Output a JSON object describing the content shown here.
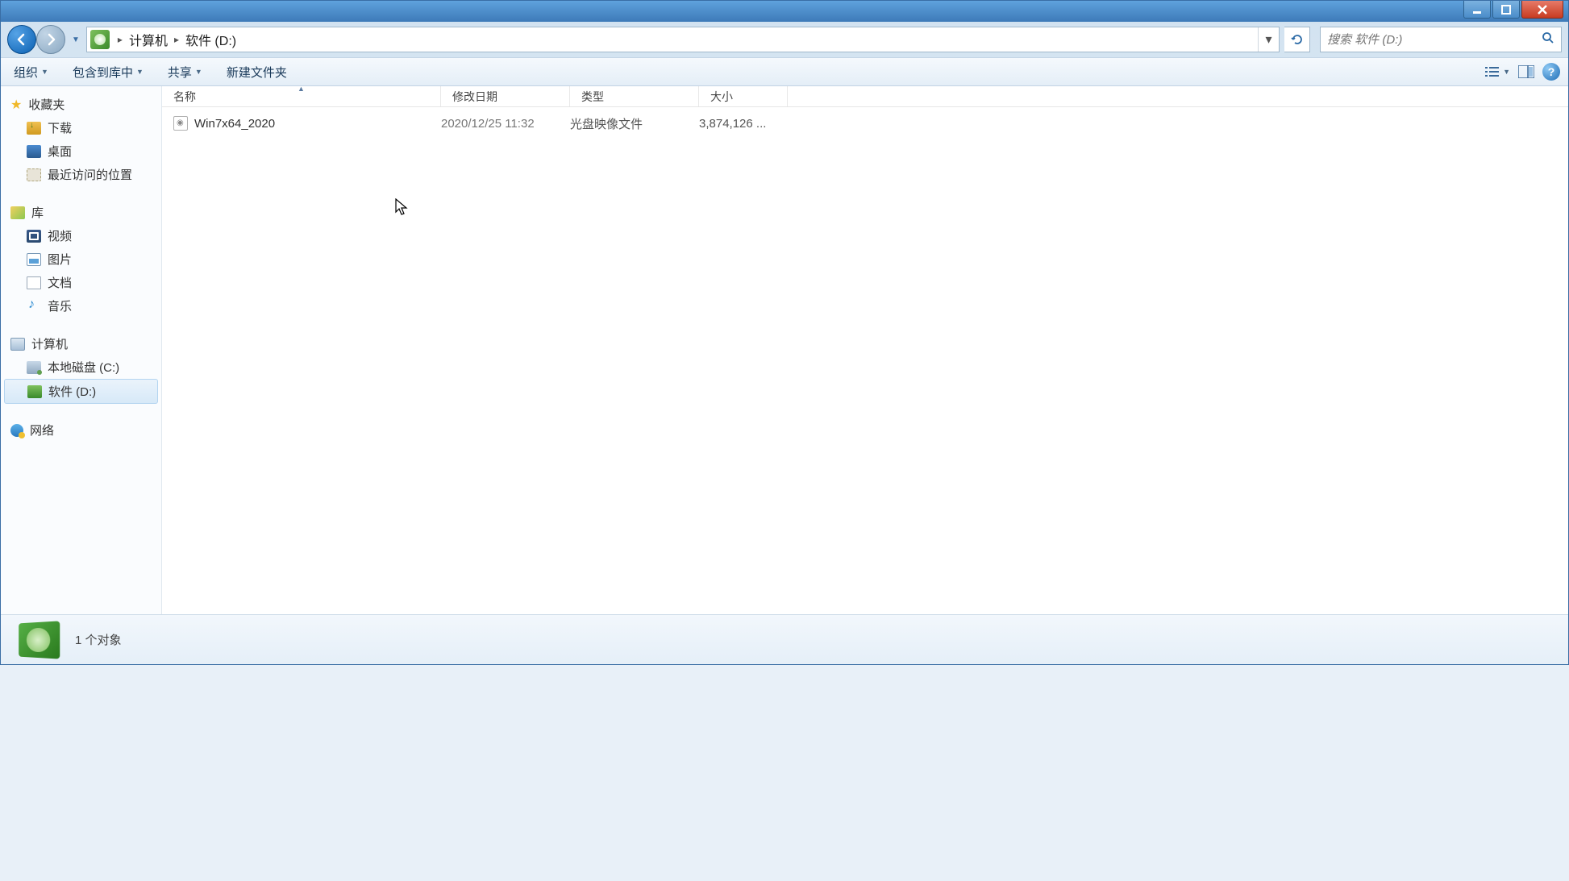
{
  "breadcrumb": {
    "part1": "计算机",
    "part2": "软件 (D:)"
  },
  "search": {
    "placeholder": "搜索 软件 (D:)"
  },
  "toolbar": {
    "organize": "组织",
    "include": "包含到库中",
    "share": "共享",
    "newfolder": "新建文件夹"
  },
  "columns": {
    "name": "名称",
    "date": "修改日期",
    "type": "类型",
    "size": "大小"
  },
  "sidebar": {
    "favorites": "收藏夹",
    "downloads": "下载",
    "desktop": "桌面",
    "recent": "最近访问的位置",
    "libraries": "库",
    "videos": "视频",
    "pictures": "图片",
    "documents": "文档",
    "music": "音乐",
    "computer": "计算机",
    "drive_c": "本地磁盘 (C:)",
    "drive_d": "软件 (D:)",
    "network": "网络"
  },
  "files": [
    {
      "name": "Win7x64_2020",
      "date": "2020/12/25 11:32",
      "type": "光盘映像文件",
      "size": "3,874,126 ..."
    }
  ],
  "status": {
    "count": "1 个对象"
  }
}
